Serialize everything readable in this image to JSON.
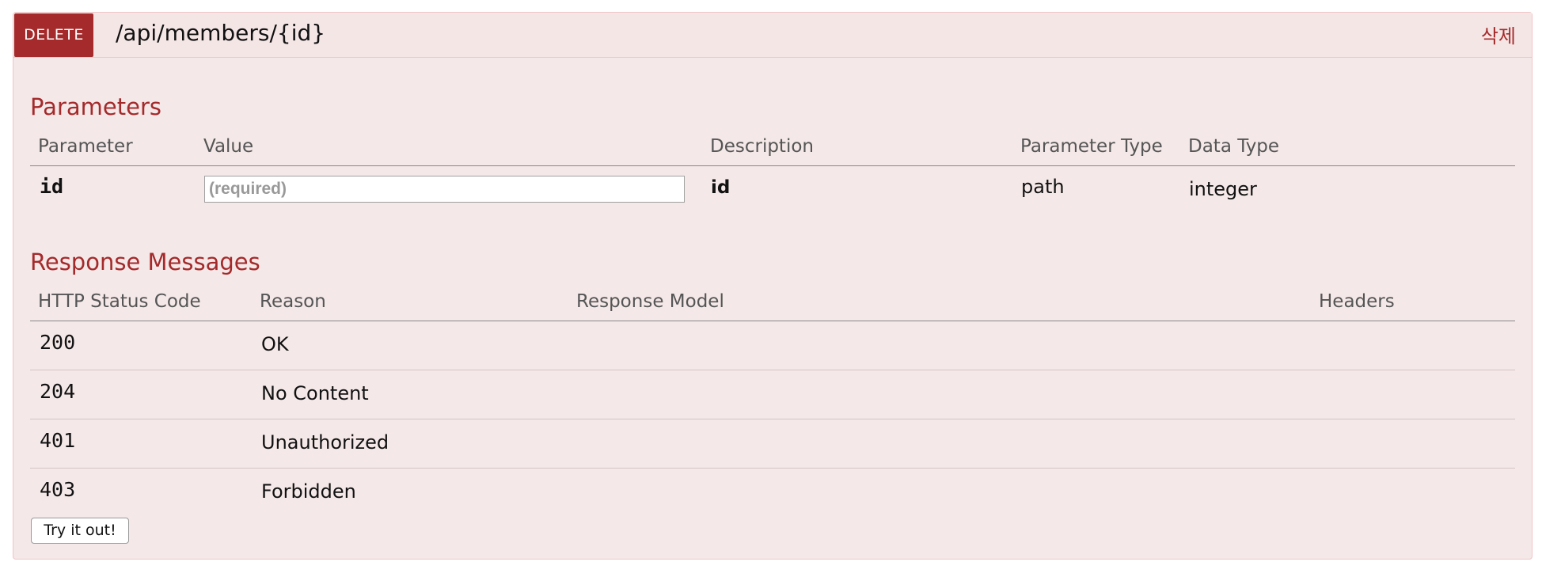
{
  "endpoint": {
    "method": "DELETE",
    "path": "/api/members/{id}",
    "summary": "삭제",
    "method_color": "#a42a2b",
    "background_color": "#f5e8e8"
  },
  "parameters": {
    "title": "Parameters",
    "headers": {
      "parameter": "Parameter",
      "value": "Value",
      "description": "Description",
      "parameter_type": "Parameter Type",
      "data_type": "Data Type"
    },
    "rows": [
      {
        "name": "id",
        "value": "",
        "placeholder": "(required)",
        "description": "id",
        "parameter_type": "path",
        "data_type": "integer"
      }
    ]
  },
  "responses": {
    "title": "Response Messages",
    "headers": {
      "status_code": "HTTP Status Code",
      "reason": "Reason",
      "response_model": "Response Model",
      "headers": "Headers"
    },
    "rows": [
      {
        "code": "200",
        "reason": "OK"
      },
      {
        "code": "204",
        "reason": "No Content"
      },
      {
        "code": "401",
        "reason": "Unauthorized"
      },
      {
        "code": "403",
        "reason": "Forbidden"
      }
    ]
  },
  "actions": {
    "try_label": "Try it out!"
  }
}
